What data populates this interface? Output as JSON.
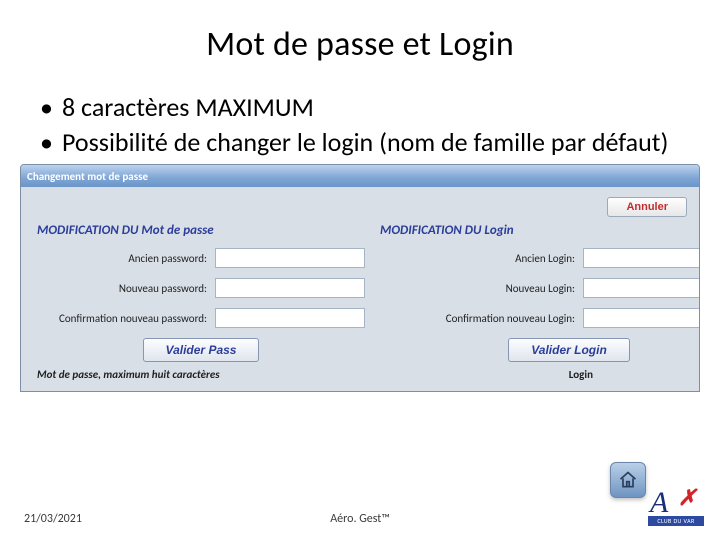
{
  "title": "Mot de passe et Login",
  "bullets": [
    "8 caractères MAXIMUM",
    "Possibilité de changer le login (nom de famille par défaut)"
  ],
  "window": {
    "titlebar": "Changement mot de passe",
    "cancel": "Annuler",
    "header_left": "MODIFICATION DU Mot de passe",
    "header_right": "MODIFICATION DU Login",
    "left": {
      "label1": "Ancien password:",
      "label2": "Nouveau password:",
      "label3": "Confirmation nouveau password:",
      "val1": "",
      "val2": "",
      "val3": "",
      "validate": "Valider Pass",
      "footer": "Mot de passe, maximum huit caractères"
    },
    "right": {
      "label1": "Ancien Login:",
      "label2": "Nouveau Login:",
      "label3": "Confirmation nouveau Login:",
      "val1": "",
      "val2": "",
      "val3": "",
      "validate": "Valider Login",
      "footer": "Login"
    }
  },
  "slide_date": "21/03/2021",
  "slide_footer": "Aéro. Gest™",
  "logo": {
    "text": "CLUB DU VAR"
  }
}
